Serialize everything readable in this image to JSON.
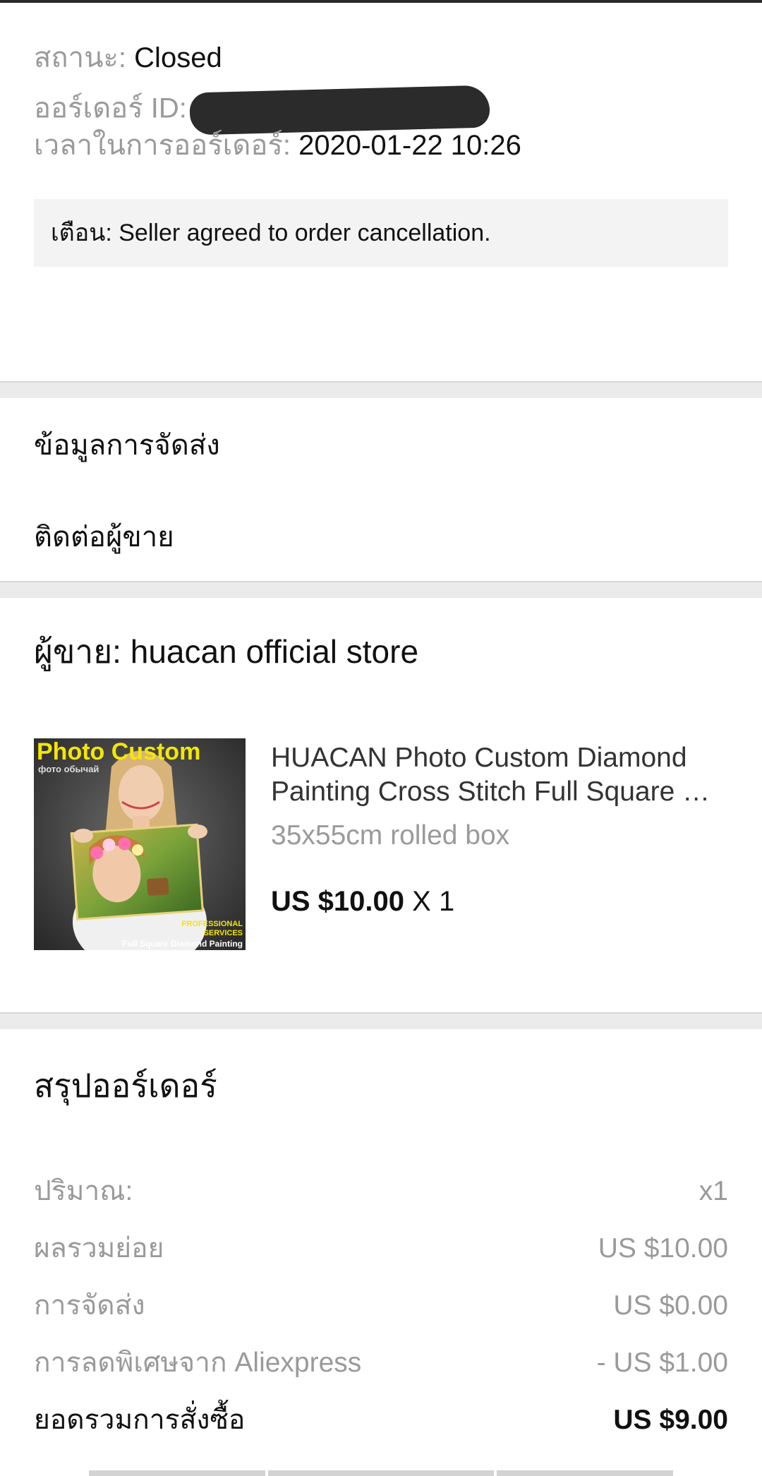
{
  "order": {
    "status_label": "สถานะ:",
    "status_value": "Closed",
    "id_label": "ออร์เดอร์ ID:",
    "time_label": "เวลาในการออร์เดอร์:",
    "time_value": "2020-01-22 10:26",
    "notice": "เตือน: Seller agreed to order cancellation."
  },
  "links": {
    "shipping_info": "ข้อมูลการจัดส่ง",
    "contact_seller": "ติดต่อผู้ขาย"
  },
  "seller": {
    "label": "ผู้ขาย: huacan official store"
  },
  "product": {
    "image_text_title": "Photo Custom",
    "image_text_sub": "фото обычай",
    "image_text_badge1": "PROFESSIONAL",
    "image_text_badge2": "SERVICES",
    "image_text_footer": "Full Square Diamond Painting",
    "name_line1": "HUACAN Photo Custom Diamond",
    "name_line2": "Painting Cross Stitch Full Square …",
    "variant": "35x55cm rolled box",
    "price": "US $10.00",
    "qty": " X 1"
  },
  "summary": {
    "title": "สรุปออร์เดอร์",
    "rows": [
      {
        "label": "ปริมาณ:",
        "value": "x1"
      },
      {
        "label": "ผลรวมย่อย",
        "value": "US $10.00"
      },
      {
        "label": "การจัดส่ง",
        "value": "US $0.00"
      },
      {
        "label": "การลดพิเศษจาก Aliexpress",
        "value": "- US $1.00"
      }
    ],
    "total_label": "ยอดรวมการสั่งซื้อ",
    "total_value": "US $9.00"
  },
  "colors": {
    "label_gray": "#9a9a9a",
    "notice_bg": "#f3f3f3",
    "divider": "#ebebeb",
    "image_title_yellow": "#f5e600"
  }
}
